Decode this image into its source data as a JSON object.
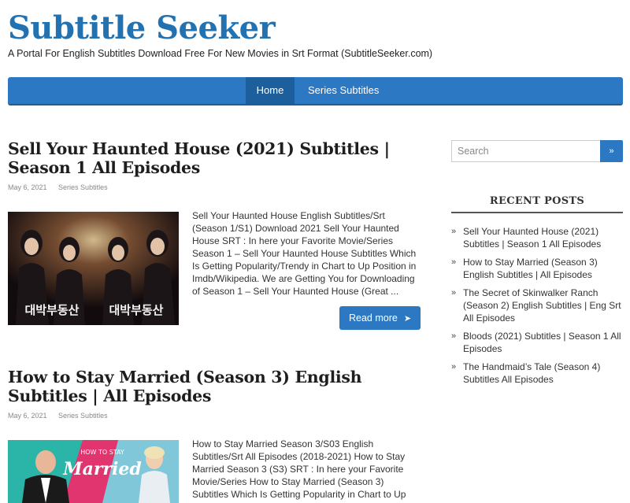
{
  "site": {
    "title": "Subtitle Seeker",
    "description": "A Portal For English Subtitles Download Free For New Movies in Srt Format (SubtitleSeeker.com)"
  },
  "nav": {
    "items": [
      "Home",
      "Series Subtitles"
    ]
  },
  "posts": [
    {
      "title": "Sell Your Haunted House (2021) Subtitles | Season 1 All Episodes",
      "date": "May 6, 2021",
      "category": "Series Subtitles",
      "excerpt": "Sell Your Haunted House English Subtitles/Srt (Season 1/S1) Download 2021 Sell Your Haunted House SRT : In here your Favorite Movie/Series Season 1 – Sell Your Haunted House Subtitles Which Is Getting Popularity/Trendy in Chart to Up Position in Imdb/Wikipedia. We are Getting You for Downloading of Season 1 –  Sell Your Haunted House (Great ...",
      "read_more": "Read more",
      "thumb_text_left": "대박부동산",
      "thumb_text_right": "대박부동산"
    },
    {
      "title": "How to Stay Married (Season 3) English Subtitles | All Episodes",
      "date": "May 6, 2021",
      "category": "Series Subtitles",
      "excerpt": "How to Stay Married Season 3/S03 English Subtitles/Srt All Episodes (2018-2021)  How to Stay Married Season 3 (S3) SRT : In here your Favorite Movie/Series How to Stay Married (Season 3) Subtitles Which Is Getting Popularity in Chart to Up",
      "thumb_text_small": "HOW TO STAY",
      "thumb_text_big": "Married"
    }
  ],
  "sidebar": {
    "search_placeholder": "Search",
    "recent_title": "RECENT POSTS",
    "recent_posts": [
      "Sell Your Haunted House (2021) Subtitles | Season 1 All Episodes",
      "How to Stay Married (Season 3) English Subtitles | All Episodes",
      "The Secret of Skinwalker Ranch (Season 2) English Subtitles | Eng Srt All Episodes",
      "Bloods (2021) Subtitles | Season 1 All Episodes",
      "The Handmaid’s Tale (Season 4) Subtitles All Episodes"
    ]
  },
  "icons": {
    "search": "search-icon",
    "read_more_arrow": "arrow-right-icon",
    "bullet": "double-chevron-right-icon"
  },
  "colors": {
    "brand": "#2272b2",
    "nav": "#2d78c3",
    "nav_active": "#1d5e9c"
  }
}
